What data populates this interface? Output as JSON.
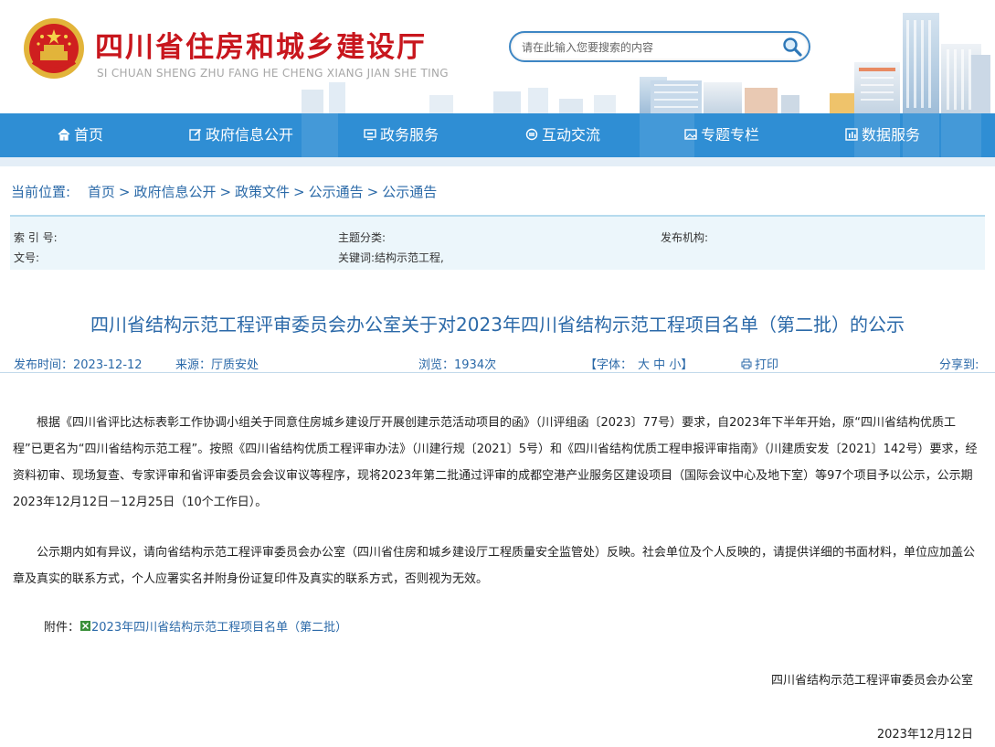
{
  "header": {
    "title": "四川省住房和城乡建设厅",
    "subtitle": "SI CHUAN SHENG ZHU FANG HE CHENG XIANG JIAN SHE TING",
    "search": {
      "placeholder": "请在此输入您要搜索的内容"
    }
  },
  "nav": {
    "items": [
      {
        "label": "首页",
        "icon": "home-icon"
      },
      {
        "label": "政府信息公开",
        "icon": "edit-icon"
      },
      {
        "label": "政务服务",
        "icon": "monitor-icon"
      },
      {
        "label": "互动交流",
        "icon": "exchange-icon"
      },
      {
        "label": "专题专栏",
        "icon": "image-icon"
      },
      {
        "label": "数据服务",
        "icon": "chart-icon"
      }
    ]
  },
  "breadcrumb": {
    "label": "当前位置:",
    "items": [
      "首页",
      "政府信息公开",
      "政策文件",
      "公示通告",
      "公示通告"
    ],
    "separator": ">"
  },
  "meta": {
    "index_label": "索 引 号:",
    "index_value": "",
    "category_label": "主题分类:",
    "category_value": "",
    "publisher_label": "发布机构:",
    "publisher_value": "",
    "docno_label": "文号:",
    "docno_value": "",
    "keywords_label": "关键词:",
    "keywords_value": "结构示范工程,"
  },
  "article": {
    "title": "四川省结构示范工程评审委员会办公室关于对2023年四川省结构示范工程项目名单（第二批）的公示",
    "publish_time": "发布时间：2023-12-12",
    "source": "来源：厅质安处",
    "views": "浏览：1934次",
    "font_label": "【字体：",
    "font_large": "大",
    "font_medium": "中",
    "font_small": "小",
    "font_end": "】",
    "print_label": "打印",
    "share_label": "分享到:",
    "paragraphs": [
      "根据《四川省评比达标表彰工作协调小组关于同意住房城乡建设厅开展创建示范活动项目的函》（川评组函〔2023〕77号）要求，自2023年下半年开始，原“四川省结构优质工程”已更名为“四川省结构示范工程”。按照《四川省结构优质工程评审办法》（川建行规〔2021〕5号）和《四川省结构优质工程申报评审指南》（川建质安发〔2021〕142号）要求，经资料初审、现场复查、专家评审和省评审委员会会议审议等程序，现将2023年第二批通过评审的成都空港产业服务区建设项目（国际会议中心及地下室）等97个项目予以公示，公示期2023年12月12日－12月25日（10个工作日）。",
      "公示期内如有异议，请向省结构示范工程评审委员会办公室（四川省住房和城乡建设厅工程质量安全监管处）反映。社会单位及个人反映的，请提供详细的书面材料，单位应加盖公章及真实的联系方式，个人应署实名并附身份证复印件及真实的联系方式，否则视为无效。"
    ],
    "attachment_label": "附件：",
    "attachment_name": "2023年四川省结构示范工程项目名单（第二批）",
    "signature": "四川省结构示范工程评审委员会办公室",
    "date": "2023年12月12日"
  },
  "colors": {
    "brand_red": "#c8161d",
    "nav_blue": "#2f8ed4",
    "link_blue": "#2b69a8",
    "meta_bg": "#ecf6fb"
  }
}
